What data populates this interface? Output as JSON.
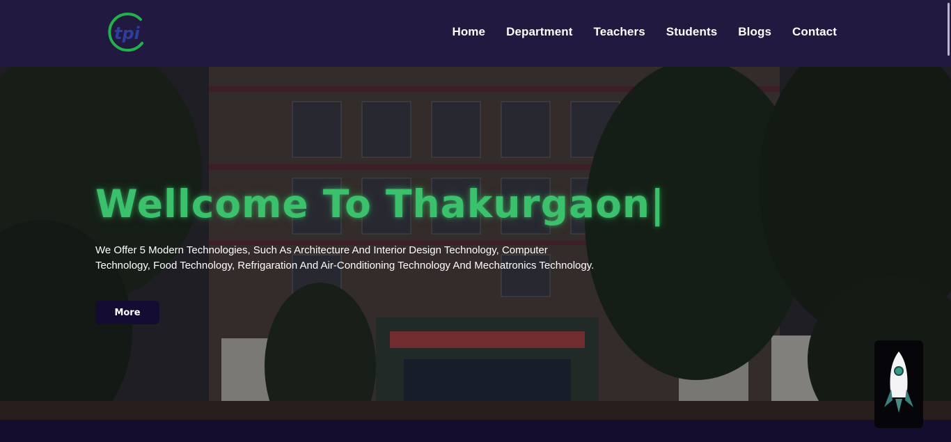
{
  "brand": {
    "logo_text": "tpi",
    "accent": "#3bc06b"
  },
  "nav": {
    "items": [
      {
        "label": "Home"
      },
      {
        "label": "Department"
      },
      {
        "label": "Teachers"
      },
      {
        "label": "Students"
      },
      {
        "label": "Blogs"
      },
      {
        "label": "Contact"
      }
    ]
  },
  "hero": {
    "title": "Wellcome To Thakurgaon|",
    "description": "We Offer 5 Modern Technologies, Such As Architecture And Interior Design Technology, Computer Technology, Food Technology, Refrigaration And Air-Conditioning Technology And Mechatronics Technology.",
    "button_label": "More",
    "background": "building-photo"
  },
  "scroll_top": {
    "icon": "rocket-icon"
  },
  "colors": {
    "nav_bg": "#21193f",
    "button_bg": "#150c33",
    "title": "#3bc06b"
  }
}
